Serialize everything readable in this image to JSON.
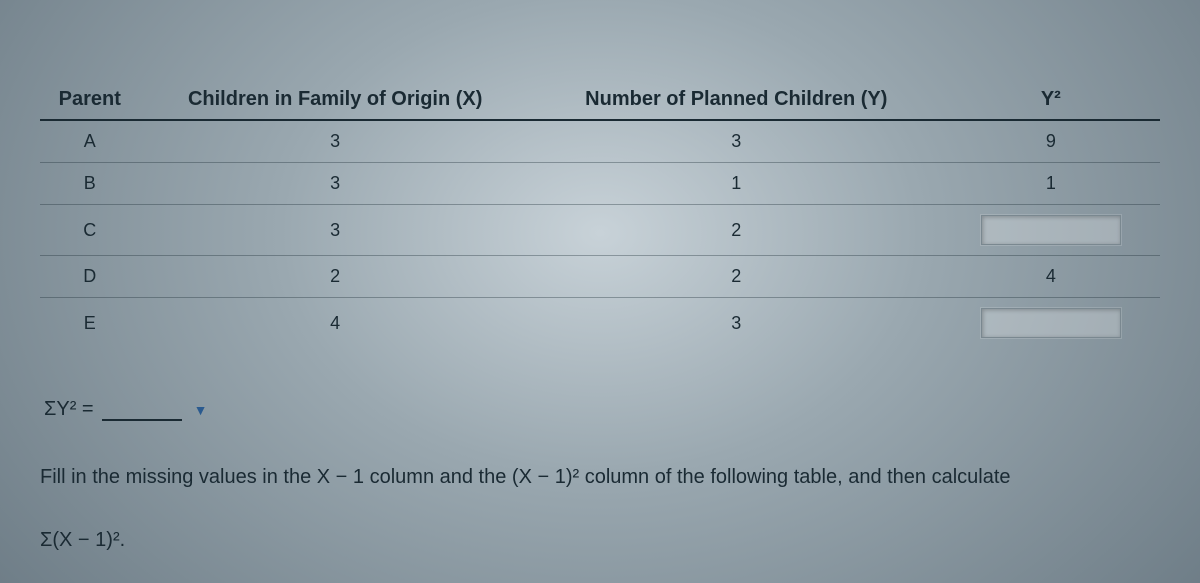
{
  "table": {
    "headers": {
      "parent": "Parent",
      "x": "Children in Family of Origin (X)",
      "y": "Number of Planned Children (Y)",
      "y2": "Y²"
    },
    "rows": [
      {
        "parent": "A",
        "x": "3",
        "y": "3",
        "y2": "9",
        "y2_input": false
      },
      {
        "parent": "B",
        "x": "3",
        "y": "1",
        "y2": "1",
        "y2_input": false
      },
      {
        "parent": "C",
        "x": "3",
        "y": "2",
        "y2": "",
        "y2_input": true
      },
      {
        "parent": "D",
        "x": "2",
        "y": "2",
        "y2": "4",
        "y2_input": false
      },
      {
        "parent": "E",
        "x": "4",
        "y": "3",
        "y2": "",
        "y2_input": true
      }
    ]
  },
  "sigma": {
    "label": "ΣY² ="
  },
  "prose": "Fill in the missing values in the X − 1 column and the (X − 1)² column of the following table, and then calculate",
  "formula": "Σ(X − 1)²."
}
